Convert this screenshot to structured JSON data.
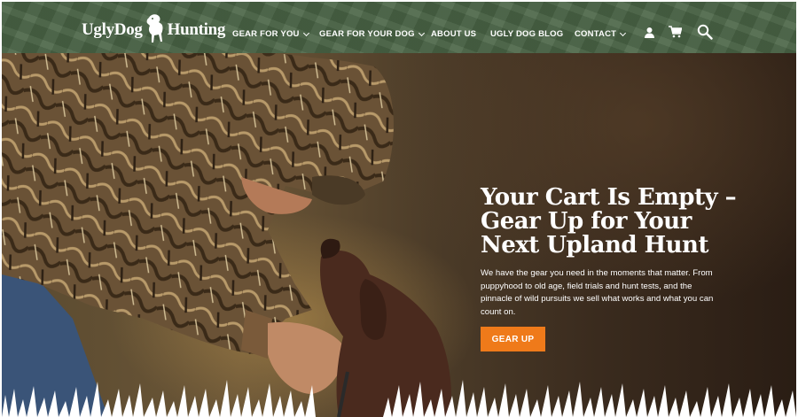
{
  "brand": {
    "logo_text_left": "UglyDog",
    "logo_text_right": "Hunting"
  },
  "nav": {
    "items": [
      {
        "label": "GEAR FOR YOU",
        "has_dropdown": true
      },
      {
        "label": "GEAR FOR YOUR DOG",
        "has_dropdown": true
      },
      {
        "label": "ABOUT US",
        "has_dropdown": false
      },
      {
        "label": "UGLY DOG BLOG",
        "has_dropdown": false
      },
      {
        "label": "CONTACT",
        "has_dropdown": true
      }
    ],
    "icons": [
      "account-icon",
      "cart-icon",
      "search-icon"
    ]
  },
  "hero": {
    "title": "Your Cart Is Empty – Gear Up for Your Next Upland Hunt",
    "body": "We have the gear you need in the moments that matter. From puppyhood to old age, field trials and hunt tests, and the pinnacle of wild pursuits we sell what works and what you can count on.",
    "cta_label": "GEAR UP"
  },
  "colors": {
    "header_green": "#4a6446",
    "cta_orange": "#ef7a1a",
    "text_white": "#ffffff"
  }
}
